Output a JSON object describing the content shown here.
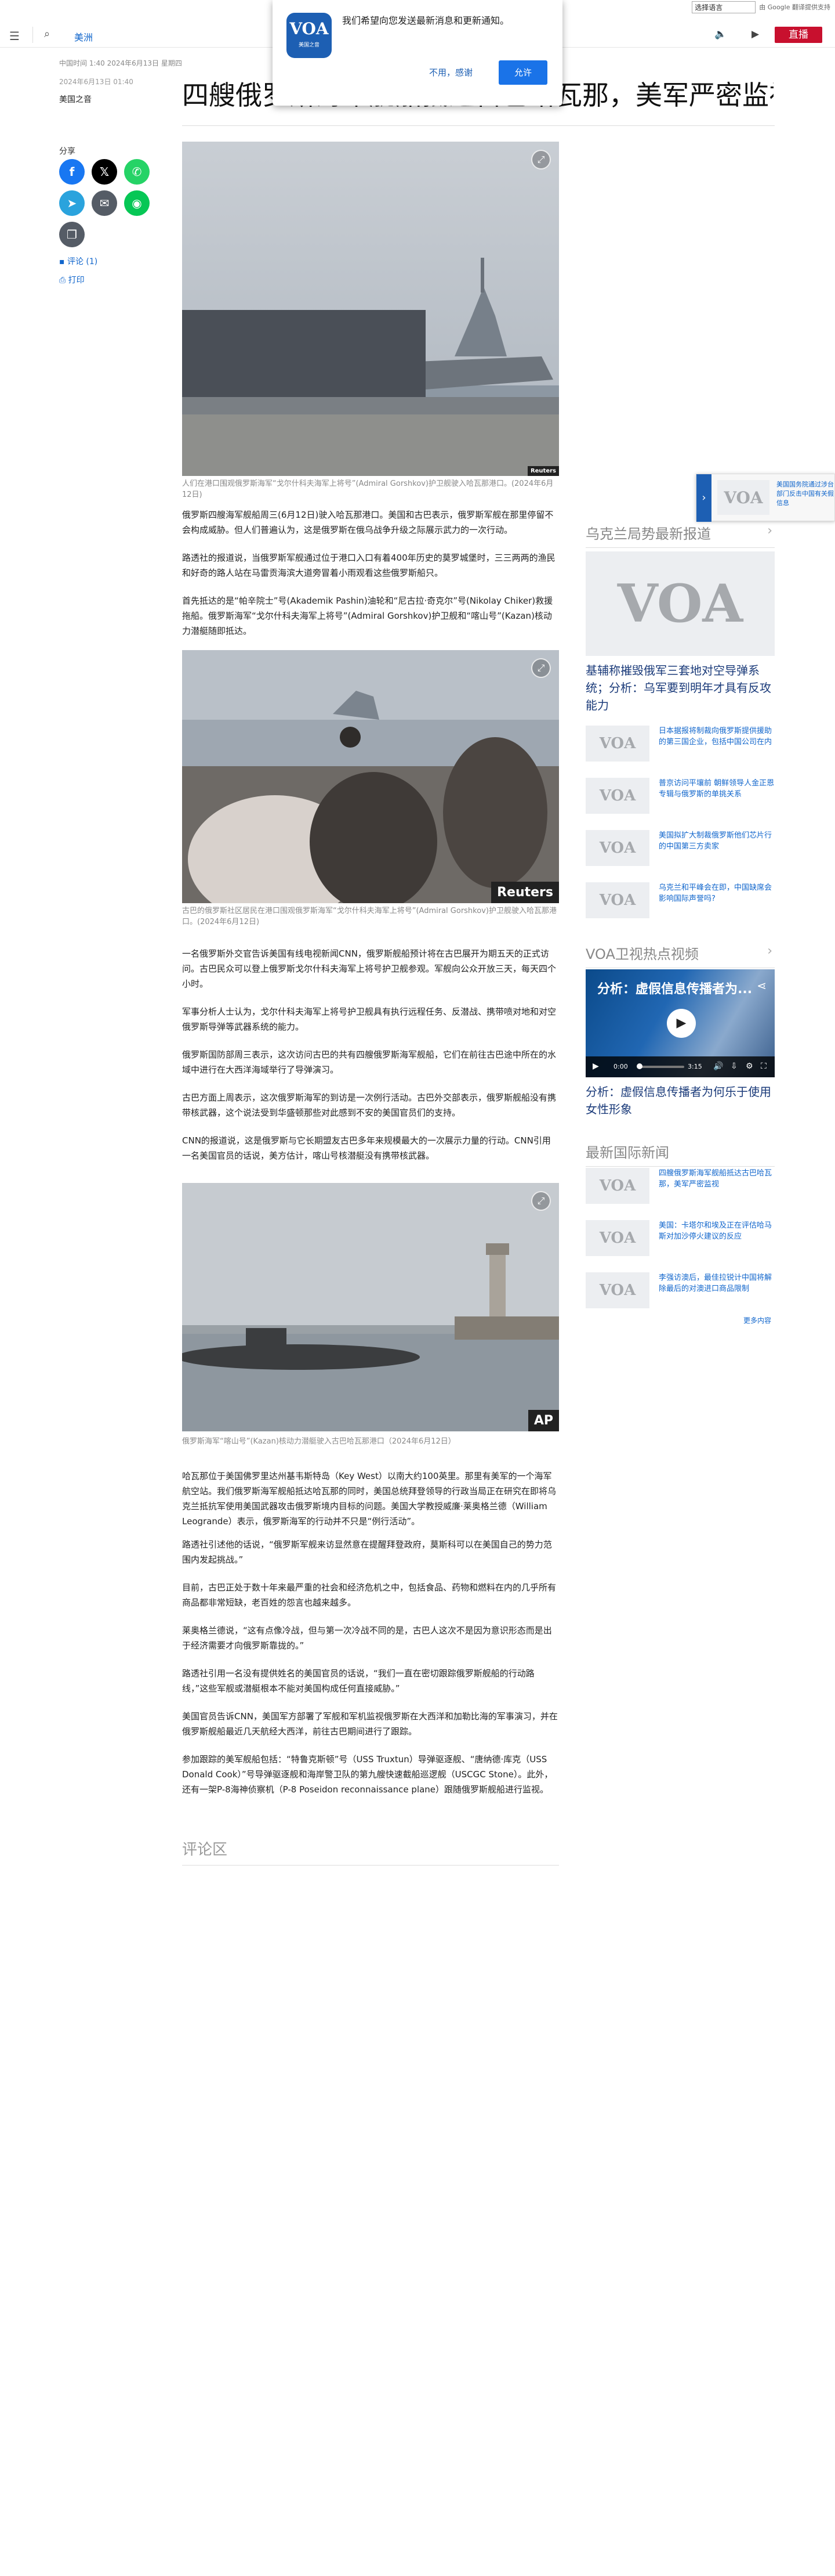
{
  "translate": {
    "select_label": "选择语言",
    "powered": "由 Google 翻译提供支持"
  },
  "header": {
    "section": "美洲",
    "live": "直播"
  },
  "notification": {
    "logo_text": "VOA",
    "logo_sub": "美国之音",
    "message": "我们希望向您发送最新消息和更新通知。",
    "deny": "不用，感谢",
    "allow": "允许"
  },
  "article": {
    "dateline": "中国时间 1:40 2024年6月13日 星期四",
    "date": "2024年6月13日 01:40",
    "region": "美国之音",
    "share_label": "分享",
    "comments_link": "评论 (1)",
    "print_link": "打印",
    "title": "四艘俄罗斯海军舰船抵达古巴哈瓦那，美军严密监视",
    "image1_caption": "人们在港口围观俄罗斯海军“戈尔什科夫海军上将号”(Admiral Gorshkov)护卫舰驶入哈瓦那港口。(2024年6月12日)",
    "image1_credit": "Reuters",
    "image2_caption": "古巴的俄罗斯社区居民在港口围观俄罗斯海军“戈尔什科夫海军上将号”(Admiral Gorshkov)护卫舰驶入哈瓦那港口。(2024年6月12日)",
    "image2_credit": "Reuters",
    "image3_caption": "俄罗斯海军“喀山号”(Kazan)核动力潜艇驶入古巴哈瓦那港口（2024年6月12日）",
    "image3_credit": "AP",
    "paragraphs": [
      "俄罗斯四艘海军舰船周三(6月12日)驶入哈瓦那港口。美国和古巴表示，俄罗斯军舰在那里停留不会构成威胁。但人们普遍认为，这是俄罗斯在俄乌战争升级之际展示武力的一次行动。",
      "路透社的报道说，当俄罗斯军舰通过位于港口入口有着400年历史的莫罗城堡时，三三两两的渔民和好奇的路人站在马雷贡海滨大道旁冒着小雨观看这些俄罗斯船只。",
      "首先抵达的是“帕辛院士”号(Akademik Pashin)油轮和“尼古拉·奇克尔”号(Nikolay Chiker)救援拖船。俄罗斯海军“戈尔什科夫海军上将号”(Admiral Gorshkov)护卫舰和“喀山号”(Kazan)核动力潜艇随即抵达。",
      "一名俄罗斯外交官告诉美国有线电视新闻CNN，俄罗斯舰船预计将在古巴展开为期五天的正式访问。古巴民众可以登上俄罗斯戈尔什科夫海军上将号护卫舰参观。军舰向公众开放三天，每天四个小时。",
      "军事分析人士认为，戈尔什科夫海军上将号护卫舰具有执行远程任务、反潜战、携带喷对地和对空俄罗斯导弹等武器系统的能力。",
      "俄罗斯国防部周三表示，这次访问古巴的共有四艘俄罗斯海军舰船，它们在前往古巴途中所在的水域中进行在大西洋海域举行了导弹演习。",
      "古巴方面上周表示，这次俄罗斯海军的到访是一次例行活动。古巴外交部表示，俄罗斯舰船没有携带核武器，这个说法受到华盛顿那些对此感到不安的美国官员们的支持。",
      "CNN的报道说，这是俄罗斯与它长期盟友古巴多年来规模最大的一次展示力量的行动。CNN引用一名美国官员的话说，美方估计，喀山号核潜艇没有携带核武器。",
      "哈瓦那位于美国佛罗里达州基韦斯特岛（Key West）以南大约100英里。那里有美军的一个海军航空站。我们俄罗斯海军舰船抵达哈瓦那的同时，美国总统拜登领导的行政当局正在研究在即将乌克兰抵抗军使用美国武器攻击俄罗斯境内目标的问题。美国大学教授威廉·莱奥格兰德（William Leogrande）表示，俄罗斯海军的行动并不只是“例行活动”。",
      "路透社引述他的话说，“俄罗斯军舰来访显然意在提醒拜登政府，莫斯科可以在美国自己的势力范围内发起挑战。”",
      "目前，古巴正处于数十年来最严重的社会和经济危机之中，包括食品、药物和燃料在内的几乎所有商品都非常短缺，老百姓的怨言也越来越多。",
      "莱奥格兰德说，“这有点像冷战，但与第一次冷战不同的是，古巴人这次不是因为意识形态而是出于经济需要才向俄罗斯靠拢的。”",
      "路透社引用一名没有提供姓名的美国官员的话说，“我们一直在密切跟踪俄罗斯舰船的行动路线，”这些军舰或潜艇根本不能对美国构成任何直接威胁。”",
      "美国官员告诉CNN，美国军方部署了军舰和军机监视俄罗斯在大西洋和加勒比海的军事演习，并在俄罗斯舰船最近几天航经大西洋，前往古巴期间进行了跟踪。",
      "参加跟踪的美军舰船包括：“特鲁克斯顿”号（USS Truxtun）导弹驱逐舰、“唐纳德·库克（USS Donald Cook）”号导弹驱逐舰和海岸警卫队的第九艘快速截船巡逻舰（USCGC Stone）。此外，还有一架P-8海神侦察机（P-8 Poseidon reconnaissance plane）跟随俄罗斯舰船进行监视。"
    ],
    "comments_heading": "评论区"
  },
  "sidebar": {
    "section1_title": "乌克兰局势最新报道",
    "feature_title": "基辅称摧毁俄军三套地对空导弹系统；分析：乌军要到明年才具有反攻能力",
    "items1": [
      "日本据报将制裁向俄罗斯提供援助的第三国企业，包括中国公司在内",
      "普京访问平壤前 朝鲜领导人金正恩专辑与俄罗斯的单挑关系",
      "美国拟扩大制裁俄罗斯他们芯片行的中国第三方卖家",
      "乌克兰和平峰会在即，中国缺席会影响国际声誉吗?"
    ],
    "section2_title": "VOA卫视热点视频",
    "video_title": "分析：虚假信息传播者为...",
    "video_time_current": "0:00",
    "video_time_total": "3:15",
    "video_caption": "分析：虚假信息传播者为何乐于使用女性形象",
    "section3_title": "最新国际新闻",
    "items3": [
      "四艘俄罗斯海军舰船抵达古巴哈瓦那，美军严密监视",
      "美国：卡塔尔和埃及正在评估哈马斯对加沙停火建议的反应",
      "李强访澳后，最佳拉锐计中国将解除最后的对澳进口商品限制"
    ],
    "more_link": "更多内容"
  },
  "promo": {
    "text": "美国国务院通过涉台部门反击中国有关假信息"
  },
  "colors": {
    "brand_blue": "#1d5fb3",
    "live_red": "#c8102e",
    "link_blue": "#1166cc"
  },
  "icons": [
    "menu-icon",
    "search-icon",
    "speaker-icon",
    "video-camera-icon",
    "facebook-icon",
    "x-twitter-icon",
    "whatsapp-icon",
    "telegram-icon",
    "email-icon",
    "line-icon",
    "copy-link-icon",
    "comment-icon",
    "print-icon",
    "expand-icon",
    "play-icon",
    "share-icon"
  ]
}
